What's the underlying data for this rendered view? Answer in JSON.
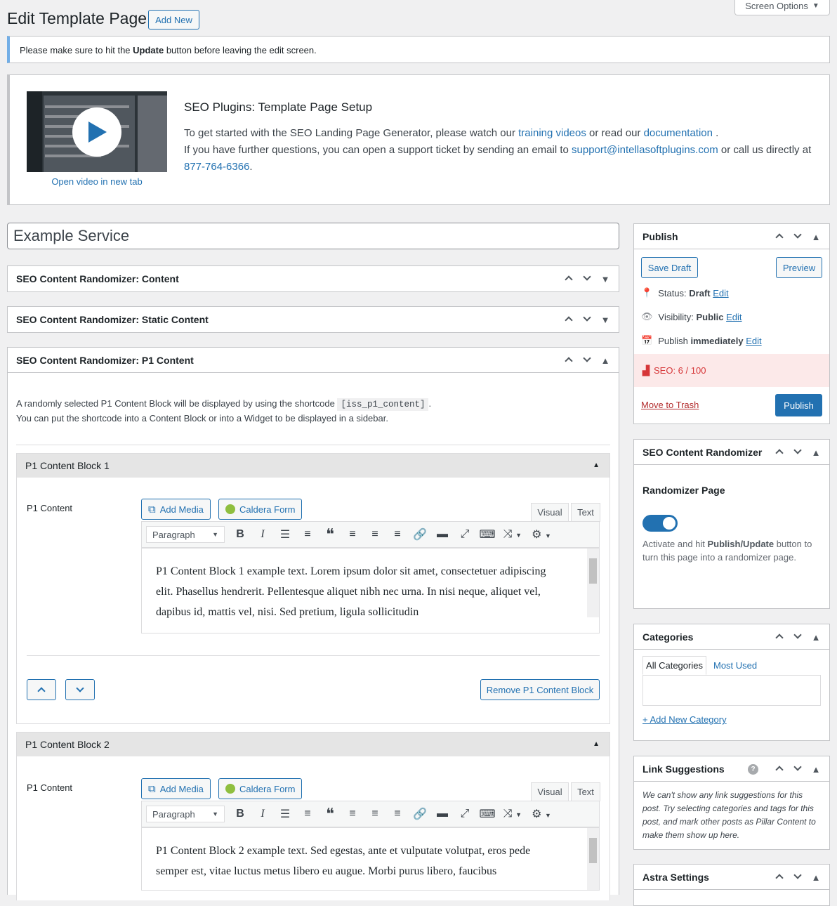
{
  "header": {
    "title": "Edit Template Page",
    "add_new": "Add New",
    "screen_options": "Screen Options"
  },
  "notice": {
    "prefix": "Please make sure to hit the ",
    "bold": "Update",
    "suffix": " button before leaving the edit screen."
  },
  "setup": {
    "open_video": "Open video in new tab",
    "title": "SEO Plugins: Template Page Setup",
    "line1_prefix": "To get started with the SEO Landing Page Generator, please watch our ",
    "training_link": "training videos",
    "line1_mid": " or read our ",
    "doc_link": "documentation",
    "line1_suffix": " .",
    "line2_prefix": "If you have further questions, you can open a support ticket by sending an email to ",
    "email_link": "support@intellasoftplugins.com",
    "line2_mid": " or call us directly at ",
    "phone_link": "877-764-6366",
    "line2_suffix": "."
  },
  "post_title": "Example Service",
  "boxes": {
    "content": "SEO Content Randomizer: Content",
    "static": "SEO Content Randomizer: Static Content",
    "p1": "SEO Content Randomizer: P1 Content"
  },
  "p1": {
    "desc1_prefix": "A randomly selected P1 Content Block will be displayed by using the shortcode ",
    "shortcode": "[iss_p1_content]",
    "desc1_suffix": ".",
    "desc2": "You can put the shortcode into a Content Block or into a Widget to be displayed in a sidebar.",
    "blocks": [
      {
        "title": "P1 Content Block 1",
        "label": "P1 Content",
        "text": "P1 Content Block 1 example text. Lorem ipsum dolor sit amet, consectetuer adipiscing elit. Phasellus hendrerit. Pellentesque aliquet nibh nec urna. In nisi neque, aliquet vel, dapibus id, mattis vel, nisi. Sed pretium, ligula sollicitudin"
      },
      {
        "title": "P1 Content Block 2",
        "label": "P1 Content",
        "text": "P1 Content Block 2 example text. Sed egestas, ante et vulputate volutpat, eros pede semper est, vitae luctus metus libero eu augue. Morbi purus libero, faucibus"
      }
    ],
    "add_media": "Add Media",
    "caldera_form": "Caldera Form",
    "tab_visual": "Visual",
    "tab_text": "Text",
    "paragraph": "Paragraph",
    "remove_block": "Remove P1 Content Block"
  },
  "publish": {
    "title": "Publish",
    "save_draft": "Save Draft",
    "preview": "Preview",
    "status_label": "Status: ",
    "status_value": "Draft",
    "visibility_label": "Visibility: ",
    "visibility_value": "Public",
    "publish_label": "Publish ",
    "publish_value": "immediately",
    "edit": "Edit",
    "seo": "SEO: 6 / 100",
    "move_to_trash": "Move to Trash",
    "publish_btn": "Publish"
  },
  "randomizer": {
    "title": "SEO Content Randomizer",
    "heading": "Randomizer Page",
    "toggle_on": true,
    "desc_prefix": "Activate and hit ",
    "desc_bold": "Publish/Update",
    "desc_suffix": " button to turn this page into a randomizer page."
  },
  "categories": {
    "title": "Categories",
    "tab_all": "All Categories",
    "tab_most": "Most Used",
    "add_new": "+ Add New Category"
  },
  "links": {
    "title": "Link Suggestions",
    "text": "We can't show any link suggestions for this post. Try selecting categories and tags for this post, and mark other posts as Pillar Content to make them show up here."
  },
  "astra": {
    "title": "Astra Settings"
  },
  "colors": {
    "accent": "#2271b1",
    "seo_bg": "#fce9e9",
    "seo_text": "#d63638",
    "notice_border": "#72aee6"
  }
}
